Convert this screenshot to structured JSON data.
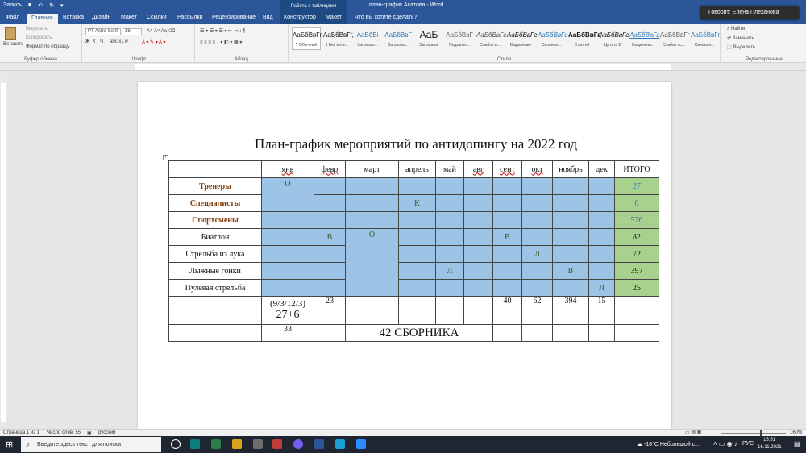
{
  "window": {
    "autosave": "Запись",
    "title": "план-график Асатова - Word",
    "context_group": "Работа с таблицами",
    "tell_me": "Что вы хотите сделать?",
    "toast": "Говорит: Елена Плеханова"
  },
  "tabs": [
    "Файл",
    "Главная",
    "Вставка",
    "Дизайн",
    "Макет",
    "Ссылки",
    "Рассылки",
    "Рецензирование",
    "Вид",
    "Конструктор",
    "Макет"
  ],
  "ribbon": {
    "clipboard": {
      "paste": "Вставить",
      "cut": "Вырезать",
      "copy": "Копировать",
      "format_painter": "Формат по образцу",
      "name": "Буфер обмена"
    },
    "font": {
      "font_name": "PT Astra Serif",
      "font_size": "16",
      "name": "Шрифт"
    },
    "paragraph": {
      "name": "Абзац"
    },
    "styles": {
      "name": "Стили",
      "items": [
        {
          "preview": "АаБбВвГг,",
          "label": "¶ Обычный"
        },
        {
          "preview": "АаБбВвГг,",
          "label": "¶ Без инте..."
        },
        {
          "preview": "АаБбВі",
          "label": "Заголово..."
        },
        {
          "preview": "АаБбВвГ",
          "label": "Заголово..."
        },
        {
          "preview": "АаБ",
          "label": "Заголовок"
        },
        {
          "preview": "АаБбВвГ",
          "label": "Подзагол..."
        },
        {
          "preview": "АаБбВвГг",
          "label": "Слабое в..."
        },
        {
          "preview": "АаБбВвГг",
          "label": "Выделение"
        },
        {
          "preview": "АаБбВвГг",
          "label": "Сильное..."
        },
        {
          "preview": "АаБбВвГг,",
          "label": "Строгий"
        },
        {
          "preview": "АаБбВвГг",
          "label": "Цитата 2"
        },
        {
          "preview": "АаБбВвГг",
          "label": "Выделенн..."
        },
        {
          "preview": "АаБбВвГг",
          "label": "Слабая сс..."
        },
        {
          "preview": "АаБбВвГг",
          "label": "Сильная..."
        }
      ]
    },
    "editing": {
      "find": "Найти",
      "replace": "Заменить",
      "select": "Выделить",
      "name": "Редактирование"
    }
  },
  "document": {
    "title": "План-график мероприятий по антидопингу на 2022 год",
    "header": [
      "",
      "янв",
      "февр",
      "март",
      "апрель",
      "май",
      "авг",
      "сент",
      "окт",
      "ноябрь",
      "дек",
      "ИТОГО"
    ],
    "rows": [
      {
        "label": "Тренеры",
        "jan": "О",
        "total": "27"
      },
      {
        "label": "Специалисты",
        "apr": "К",
        "total": "6"
      },
      {
        "label": "Спортсмены",
        "total": "576"
      },
      {
        "label": "Биатлон",
        "feb": "В",
        "mar": "О",
        "sep": "В",
        "total": "82"
      },
      {
        "label": "Стрельба из лука",
        "oct": "Л",
        "total": "72"
      },
      {
        "label": "Лыжные гонки",
        "may": "Л",
        "nov": "В",
        "total": "397"
      },
      {
        "label": "Пулевая стрельба",
        "dec": "Л",
        "total": "25"
      }
    ],
    "sum_row": {
      "jan_top": "(9/3/12/3)",
      "jan_bottom": "27+6",
      "feb": "23",
      "sep": "40",
      "oct": "62",
      "nov": "394",
      "dec": "15"
    },
    "last_row": {
      "jan": "33",
      "merged": "42 СБОРНИКА"
    }
  },
  "status": {
    "page": "Страница 1 из 1",
    "words": "Число слов: 55",
    "lang": "русский",
    "zoom": "160%"
  },
  "taskbar": {
    "search_placeholder": "Введите здесь текст для поиска",
    "weather": "-18°C  Небольшой с...",
    "lang": "РУС",
    "time": "15:51",
    "date": "16.11.2021"
  }
}
